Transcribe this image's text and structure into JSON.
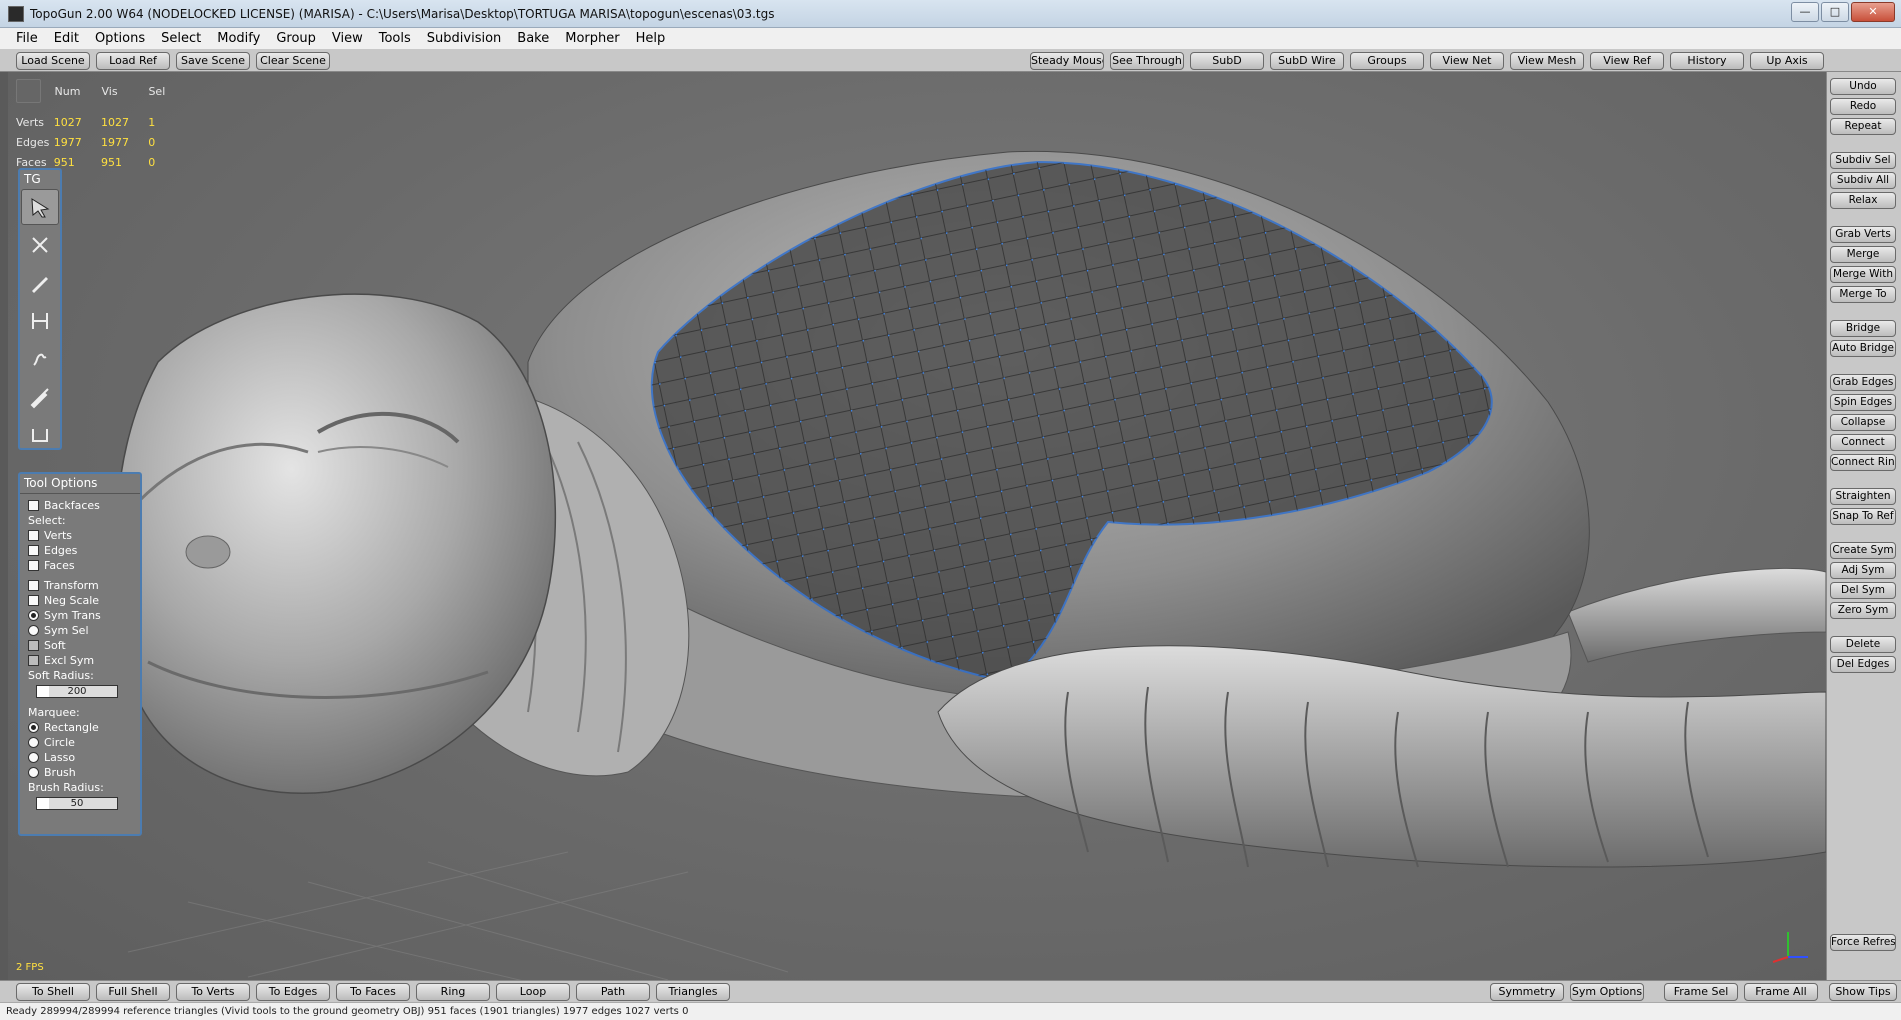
{
  "window": {
    "title": "TopoGun 2.00 W64  (NODELOCKED LICENSE) (MARISA) - C:\\Users\\Marisa\\Desktop\\TORTUGA MARISA\\topogun\\escenas\\03.tgs",
    "minimize": "—",
    "maximize": "□",
    "close": "✕"
  },
  "menu": [
    "File",
    "Edit",
    "Options",
    "Select",
    "Modify",
    "Group",
    "View",
    "Tools",
    "Subdivision",
    "Bake",
    "Morpher",
    "Help"
  ],
  "top_toolbar": {
    "left": [
      "Load Scene",
      "Load Ref",
      "Save Scene",
      "Clear Scene"
    ],
    "right": [
      "Steady Mouse",
      "See Through",
      "SubD",
      "SubD Wire",
      "Groups",
      "View Net",
      "View Mesh",
      "View Ref",
      "History",
      "Up Axis"
    ]
  },
  "stats": {
    "headers": [
      "Num",
      "Vis",
      "Sel"
    ],
    "rows": [
      {
        "label": "Verts",
        "num": "1027",
        "vis": "1027",
        "sel": "1"
      },
      {
        "label": "Edges",
        "num": "1977",
        "vis": "1977",
        "sel": "0"
      },
      {
        "label": "Faces",
        "num": "951",
        "vis": "951",
        "sel": "0"
      }
    ]
  },
  "tg_panel": {
    "title": "TG",
    "tools": [
      "select-tool-icon",
      "cut-tool-icon",
      "draw-tool-icon",
      "bridge-tool-icon",
      "brush-tool-icon",
      "paint-tool-icon",
      "extrude-tool-icon"
    ]
  },
  "tool_options": {
    "title": "Tool Options",
    "backfaces": "Backfaces",
    "select_label": "Select:",
    "verts": "Verts",
    "edges": "Edges",
    "faces": "Faces",
    "transform": "Transform",
    "neg_scale": "Neg Scale",
    "sym_trans": "Sym Trans",
    "sym_sel": "Sym Sel",
    "soft": "Soft",
    "excl_sym": "Excl Sym",
    "soft_radius_label": "Soft Radius:",
    "soft_radius_value": "200",
    "soft_radius_fraction": 0.15,
    "marquee_label": "Marquee:",
    "rectangle": "Rectangle",
    "circle": "Circle",
    "lasso": "Lasso",
    "brush": "Brush",
    "brush_radius_label": "Brush Radius:",
    "brush_radius_value": "50",
    "brush_radius_fraction": 0.15
  },
  "fps": "2 FPS",
  "right_panel": [
    "Undo",
    "Redo",
    "Repeat",
    "Subdiv Sel",
    "Subdiv All",
    "Relax",
    "Grab Verts",
    "Merge",
    "Merge With",
    "Merge To",
    "Bridge",
    "Auto Bridge",
    "Grab Edges",
    "Spin Edges",
    "Collapse",
    "Connect",
    "Connect Ring",
    "Straighten",
    "Snap To Ref",
    "Create Sym",
    "Adj Sym",
    "Del Sym",
    "Zero Sym",
    "Delete",
    "Del Edges",
    "Force Refresh"
  ],
  "bottom_toolbar": {
    "left": [
      "To Shell",
      "Full Shell",
      "To Verts",
      "To Edges",
      "To Faces",
      "Ring",
      "Loop",
      "Path",
      "Triangles"
    ],
    "right": [
      "Symmetry",
      "Sym Options",
      "Frame Sel",
      "Frame All",
      "Show Tips"
    ]
  },
  "status": "Ready        289994/289994 reference triangles (Vivid tools to the ground geometry OBJ)  951 faces (1901 triangles) 1977 edges 1027 verts 0",
  "colors": {
    "accent": "#4c7cb0",
    "stat_value": "#ffe040",
    "vertex": "#3a8cff",
    "mesh_fill": "#4a4a4a"
  }
}
